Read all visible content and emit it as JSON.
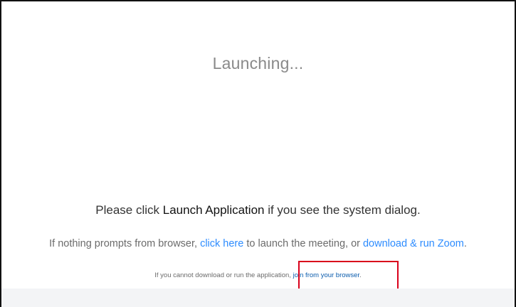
{
  "status": {
    "launching_text": "Launching..."
  },
  "instruction": {
    "prefix": "Please click ",
    "emphasis": "Launch Application",
    "suffix": " if you see the system dialog."
  },
  "fallback": {
    "prefix": "If nothing prompts from browser, ",
    "click_here_label": "click here",
    "middle": " to launch the meeting, or ",
    "download_label": "download & run Zoom",
    "suffix": "."
  },
  "browser_line": {
    "prefix": "If you cannot download or run the application, ",
    "join_label": "join from your browser",
    "suffix": "."
  },
  "colors": {
    "link": "#2d8cff",
    "highlight": "#d9001b"
  }
}
